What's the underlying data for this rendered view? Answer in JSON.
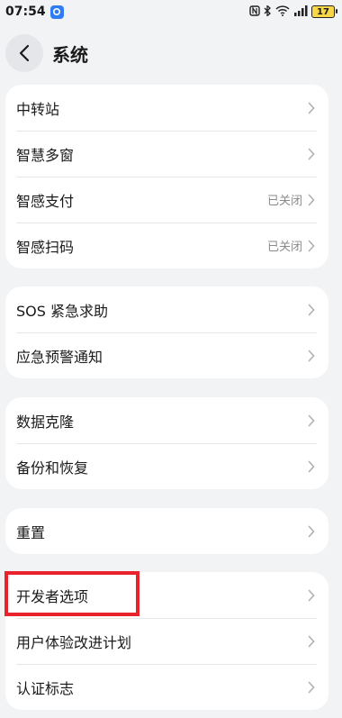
{
  "status_bar": {
    "time": "07:54",
    "battery": "17",
    "icons": [
      "nfc-icon",
      "bluetooth-icon",
      "wifi-icon",
      "signal-icon",
      "battery-icon"
    ]
  },
  "header": {
    "title": "系统"
  },
  "colors": {
    "accent_highlight": "#e8232b",
    "background": "#f1f3f5",
    "card": "#ffffff"
  },
  "groups": [
    {
      "items": [
        {
          "label": "中转站",
          "value": ""
        },
        {
          "label": "智慧多窗",
          "value": ""
        },
        {
          "label": "智感支付",
          "value": "已关闭"
        },
        {
          "label": "智感扫码",
          "value": "已关闭"
        }
      ]
    },
    {
      "items": [
        {
          "label": "SOS 紧急求助",
          "value": ""
        },
        {
          "label": "应急预警通知",
          "value": ""
        }
      ]
    },
    {
      "items": [
        {
          "label": "数据克隆",
          "value": ""
        },
        {
          "label": "备份和恢复",
          "value": ""
        }
      ]
    },
    {
      "items": [
        {
          "label": "重置",
          "value": ""
        }
      ]
    },
    {
      "items": [
        {
          "label": "开发者选项",
          "value": ""
        },
        {
          "label": "用户体验改进计划",
          "value": ""
        },
        {
          "label": "认证标志",
          "value": ""
        }
      ]
    }
  ]
}
